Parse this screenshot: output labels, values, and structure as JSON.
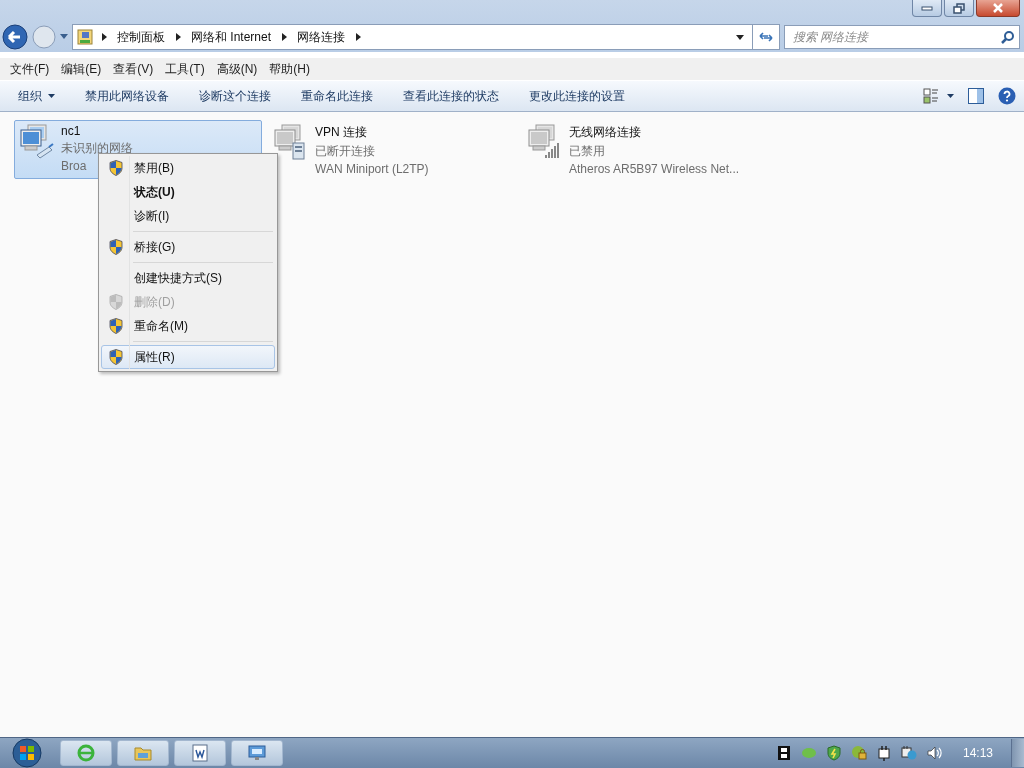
{
  "address_bar": {
    "breadcrumb": [
      "控制面板",
      "网络和 Internet",
      "网络连接"
    ]
  },
  "search": {
    "placeholder": "搜索 网络连接"
  },
  "menu_bar": [
    "文件(F)",
    "编辑(E)",
    "查看(V)",
    "工具(T)",
    "高级(N)",
    "帮助(H)"
  ],
  "toolbar": {
    "organize": "组织",
    "commands": [
      "禁用此网络设备",
      "诊断这个连接",
      "重命名此连接",
      "查看此连接的状态",
      "更改此连接的设置"
    ]
  },
  "connections": [
    {
      "kind": "wired",
      "name": "nc1",
      "status": "未识别的网络",
      "device": "Broa",
      "selected": true
    },
    {
      "kind": "vpn",
      "name": "VPN 连接",
      "status": "已断开连接",
      "device": "WAN Miniport (L2TP)",
      "selected": false
    },
    {
      "kind": "wireless",
      "name": "无线网络连接",
      "status": "已禁用",
      "device": "Atheros AR5B97 Wireless Net...",
      "selected": false
    }
  ],
  "context_menu": [
    {
      "kind": "item",
      "label": "禁用(B)",
      "shield": true,
      "bold": false,
      "disabled": false,
      "selected": false
    },
    {
      "kind": "item",
      "label": "状态(U)",
      "shield": false,
      "bold": true,
      "disabled": false,
      "selected": false
    },
    {
      "kind": "item",
      "label": "诊断(I)",
      "shield": false,
      "bold": false,
      "disabled": false,
      "selected": false
    },
    {
      "kind": "separator"
    },
    {
      "kind": "item",
      "label": "桥接(G)",
      "shield": true,
      "bold": false,
      "disabled": false,
      "selected": false
    },
    {
      "kind": "separator"
    },
    {
      "kind": "item",
      "label": "创建快捷方式(S)",
      "shield": false,
      "bold": false,
      "disabled": false,
      "selected": false
    },
    {
      "kind": "item",
      "label": "删除(D)",
      "shield": true,
      "bold": false,
      "disabled": true,
      "selected": false
    },
    {
      "kind": "item",
      "label": "重命名(M)",
      "shield": true,
      "bold": false,
      "disabled": false,
      "selected": false
    },
    {
      "kind": "separator"
    },
    {
      "kind": "item",
      "label": "属性(R)",
      "shield": true,
      "bold": false,
      "disabled": false,
      "selected": true
    }
  ],
  "taskbar": {
    "apps": [
      {
        "kind": "browser"
      },
      {
        "kind": "folder"
      },
      {
        "kind": "document"
      },
      {
        "kind": "network"
      }
    ],
    "tray": [
      {
        "kind": "film"
      },
      {
        "kind": "blob"
      },
      {
        "kind": "shield"
      },
      {
        "kind": "lock"
      },
      {
        "kind": "plug"
      },
      {
        "kind": "network"
      },
      {
        "kind": "speaker"
      }
    ],
    "clock": "14:13"
  }
}
